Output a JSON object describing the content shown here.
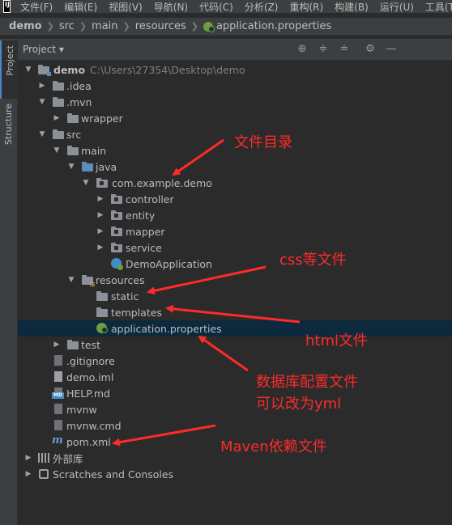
{
  "menu": {
    "logo": "IJ",
    "items": [
      "文件(F)",
      "编辑(E)",
      "视图(V)",
      "导航(N)",
      "代码(C)",
      "分析(Z)",
      "重构(R)",
      "构建(B)",
      "运行(U)",
      "工具(T)"
    ]
  },
  "breadcrumb": [
    "demo",
    "src",
    "main",
    "resources",
    "application.properties"
  ],
  "side_tabs": {
    "project": "Project",
    "structure": "Structure"
  },
  "tool_window": {
    "title": "Project ▾"
  },
  "tree": {
    "demo": {
      "label": "demo",
      "path": "C:\\Users\\27354\\Desktop\\demo"
    },
    "idea": ".idea",
    "mvn": ".mvn",
    "wrapper": "wrapper",
    "src": "src",
    "main": "main",
    "java": "java",
    "pkg": "com.example.demo",
    "controller": "controller",
    "entity": "entity",
    "mapper": "mapper",
    "service": "service",
    "demo_app": "DemoApplication",
    "resources": "resources",
    "static": "static",
    "templates": "templates",
    "app_props": "application.properties",
    "test": "test",
    "gitignore": ".gitignore",
    "demo_iml": "demo.iml",
    "help_md": "HELP.md",
    "mvnw": "mvnw",
    "mvnw_cmd": "mvnw.cmd",
    "pom": "pom.xml",
    "ext_libs": "外部库",
    "scratches": "Scratches and Consoles"
  },
  "icons": {
    "md_badge": "MD",
    "maven": "m"
  },
  "annotations": {
    "file_dir": "文件目录",
    "css_files": "css等文件",
    "html_files": "html文件",
    "db_config_1": "数据库配置文件",
    "db_config_2": "可以改为yml",
    "maven_deps": "Maven依赖文件"
  },
  "colors": {
    "annotation_red": "#ff2a2a",
    "selection": "#0d293e",
    "background": "#2b2b2b"
  }
}
